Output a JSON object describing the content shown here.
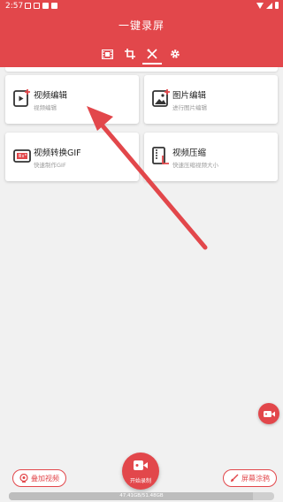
{
  "status": {
    "time": "2:57"
  },
  "app": {
    "title": "一键录屏"
  },
  "tabs": [
    {
      "name": "video",
      "icon": "film-icon"
    },
    {
      "name": "crop",
      "icon": "crop-icon"
    },
    {
      "name": "tools",
      "icon": "tools-icon",
      "active": true
    },
    {
      "name": "settings",
      "icon": "gear-icon"
    }
  ],
  "cards": [
    {
      "title": "视频编辑",
      "subtitle": "视频编辑",
      "icon": "video-edit-icon"
    },
    {
      "title": "图片编辑",
      "subtitle": "进行图片编辑",
      "icon": "image-edit-icon"
    },
    {
      "title": "视频转换GIF",
      "subtitle": "快速制作GIF",
      "icon": "gif-icon"
    },
    {
      "title": "视频压缩",
      "subtitle": "快速压缩视频大小",
      "icon": "compress-icon"
    }
  ],
  "bottom": {
    "overlay_label": "叠加视频",
    "record_label": "开始录制",
    "doodle_label": "屏幕涂鸦",
    "storage_text": "47.41GB/51.48GB",
    "storage_fraction": 0.92
  },
  "colors": {
    "accent": "#e2474b",
    "background": "#f1f1f1"
  }
}
